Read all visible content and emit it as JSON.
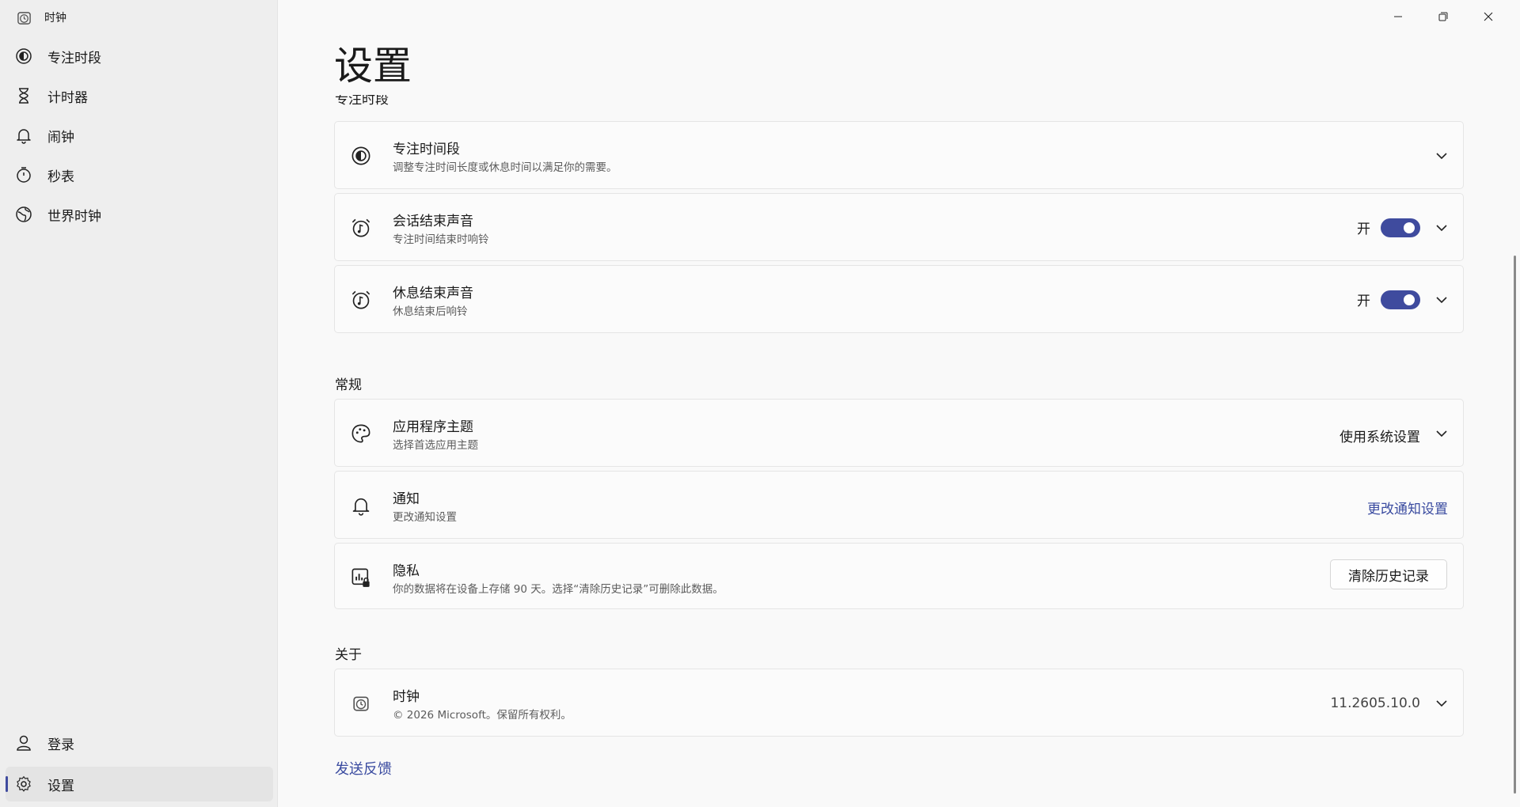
{
  "app": {
    "title": "时钟",
    "icon": "clock-app-icon"
  },
  "sidebar": {
    "items": [
      {
        "label": "专注时段",
        "icon": "focus-icon"
      },
      {
        "label": "计时器",
        "icon": "hourglass-icon"
      },
      {
        "label": "闹钟",
        "icon": "bell-icon"
      },
      {
        "label": "秒表",
        "icon": "stopwatch-icon"
      },
      {
        "label": "世界时钟",
        "icon": "globe-icon"
      }
    ],
    "bottom": [
      {
        "label": "登录",
        "icon": "person-icon"
      },
      {
        "label": "设置",
        "icon": "gear-icon",
        "active": true
      }
    ]
  },
  "page": {
    "title": "设置",
    "cut_section": "专注时段"
  },
  "focus": {
    "cards": [
      {
        "title": "专注时间段",
        "subtitle": "调整专注时间长度或休息时间以满足你的需要。",
        "icon": "focus-icon"
      },
      {
        "title": "会话结束声音",
        "subtitle": "专注时间结束时响铃",
        "toggle_label": "开",
        "toggle_on": true,
        "icon": "alarm-music-icon"
      },
      {
        "title": "休息结束声音",
        "subtitle": "休息结束后响铃",
        "toggle_label": "开",
        "toggle_on": true,
        "icon": "alarm-music-icon"
      }
    ]
  },
  "general": {
    "label": "常规",
    "theme": {
      "title": "应用程序主题",
      "subtitle": "选择首选应用主题",
      "value": "使用系统设置",
      "icon": "palette-icon"
    },
    "notify": {
      "title": "通知",
      "subtitle": "更改通知设置",
      "link": "更改通知设置",
      "icon": "bell-icon"
    },
    "privacy": {
      "title": "隐私",
      "subtitle": "你的数据将在设备上存储 90 天。选择“清除历史记录”可删除此数据。",
      "button": "清除历史记录",
      "icon": "privacy-chart-icon"
    }
  },
  "about": {
    "label": "关于",
    "title": "时钟",
    "subtitle": "© 2026 Microsoft。保留所有权利。",
    "version": "11.2605.10.0",
    "icon": "clock-app-icon"
  },
  "feedback": "发送反馈",
  "colors": {
    "accent": "#3f4b9e",
    "link": "#3a4ba0"
  }
}
